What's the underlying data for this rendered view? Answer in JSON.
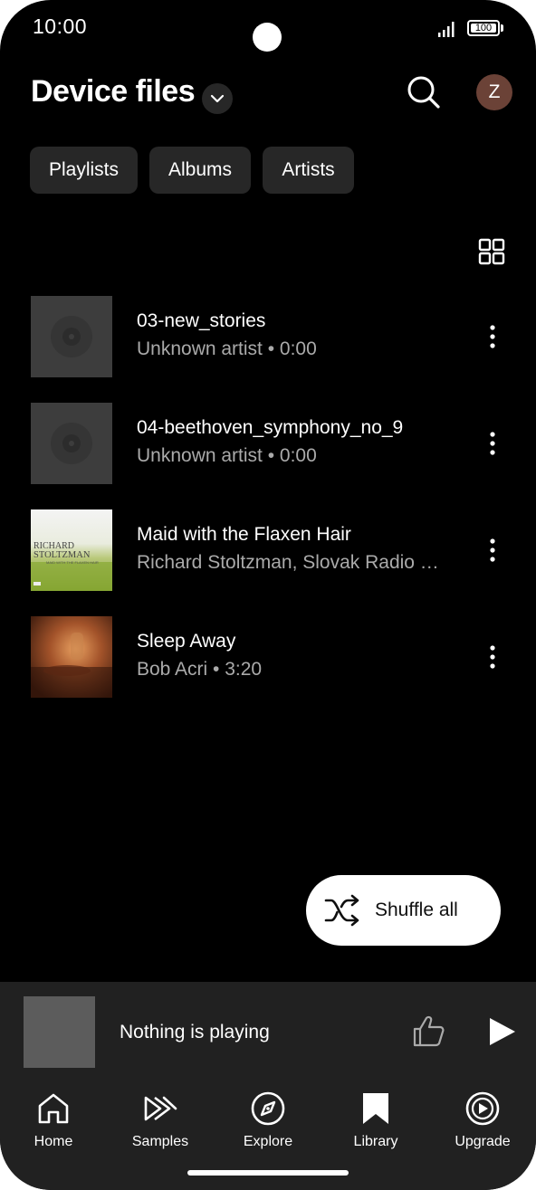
{
  "status_bar": {
    "time": "10:00",
    "battery": "100"
  },
  "header": {
    "title": "Device files"
  },
  "chips": [
    {
      "label": "Playlists"
    },
    {
      "label": "Albums"
    },
    {
      "label": "Artists"
    }
  ],
  "tracks": [
    {
      "title": "03-new_stories",
      "subtitle": "Unknown artist • 0:00",
      "art": "placeholder"
    },
    {
      "title": "04-beethoven_symphony_no_9",
      "subtitle": "Unknown artist • 0:00",
      "art": "placeholder"
    },
    {
      "title": "Maid with the Flaxen Hair",
      "subtitle": "Richard Stoltzman, Slovak Radio …",
      "art": "album-cover",
      "art_text": {
        "top": "RICHARD",
        "main": "STOLTZMAN",
        "sub": "MAID WITH THE FLAXEN HAIR"
      }
    },
    {
      "title": "Sleep Away",
      "subtitle": "Bob Acri • 3:20",
      "art": "album-cover"
    }
  ],
  "shuffle": {
    "label": "Shuffle all"
  },
  "mini_player": {
    "title": "Nothing is playing"
  },
  "nav": [
    {
      "label": "Home",
      "icon": "home-icon"
    },
    {
      "label": "Samples",
      "icon": "samples-icon"
    },
    {
      "label": "Explore",
      "icon": "explore-icon"
    },
    {
      "label": "Library",
      "icon": "library-icon"
    },
    {
      "label": "Upgrade",
      "icon": "upgrade-icon"
    }
  ],
  "avatar": {
    "initial": "Z",
    "color": "#6b4237"
  }
}
